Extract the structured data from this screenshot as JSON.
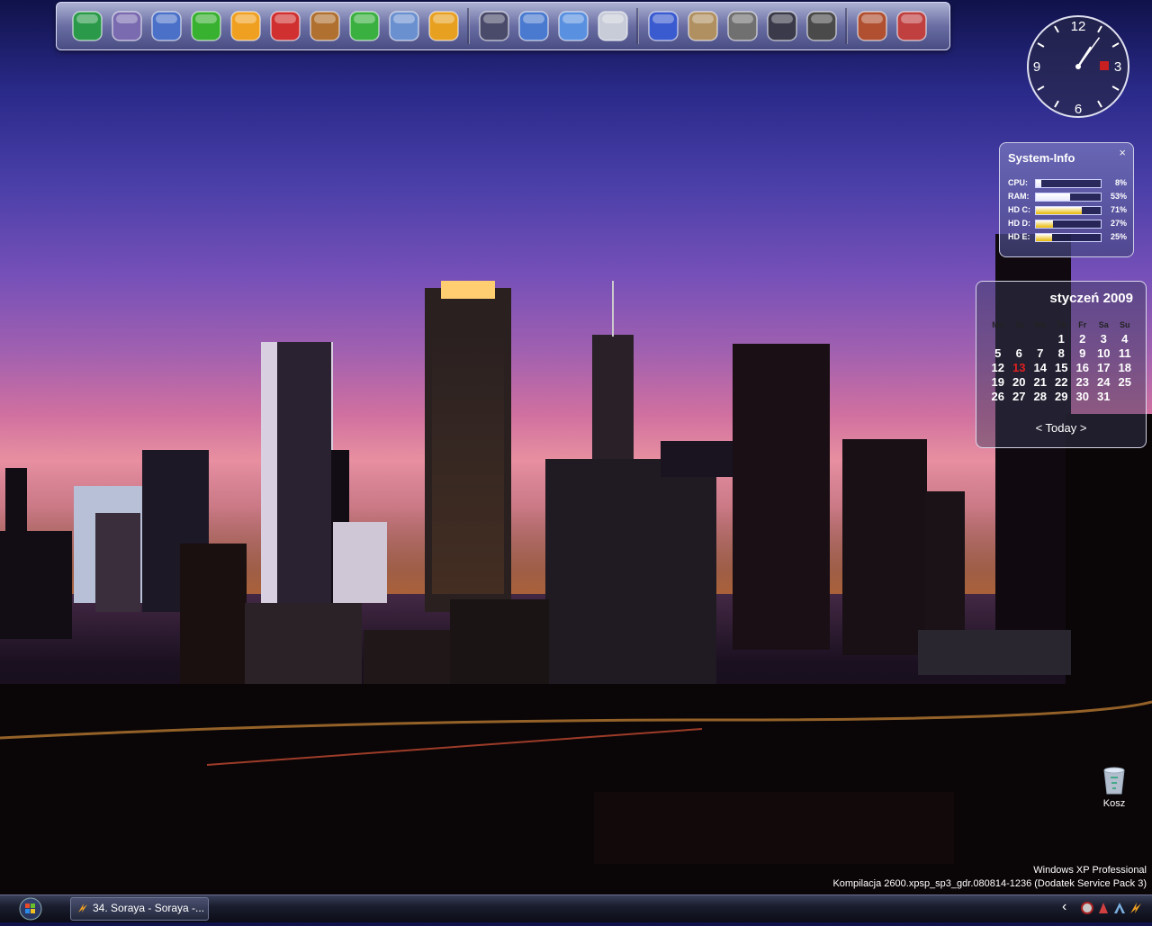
{
  "dock": {
    "icons": [
      {
        "name": "excel-icon",
        "group": 1
      },
      {
        "name": "paint-brushes-icon",
        "group": 1
      },
      {
        "name": "notes-pen-icon",
        "group": 1
      },
      {
        "name": "utorrent-icon",
        "group": 1
      },
      {
        "name": "info-icon",
        "group": 1
      },
      {
        "name": "acrobat-icon",
        "group": 1
      },
      {
        "name": "gopher-icon",
        "group": 1
      },
      {
        "name": "play-icon",
        "group": 1
      },
      {
        "name": "arch-icon",
        "group": 1
      },
      {
        "name": "winamp-icon",
        "group": 1
      },
      {
        "name": "media-tool-icon",
        "group": 2
      },
      {
        "name": "registry-cubes-icon",
        "group": 2
      },
      {
        "name": "cleanup-brush-icon",
        "group": 2
      },
      {
        "name": "disk-icon",
        "group": 2
      },
      {
        "name": "butterfly-network-icon",
        "group": 3
      },
      {
        "name": "archive-stack-icon",
        "group": 3
      },
      {
        "name": "film-reel-icon",
        "group": 3
      },
      {
        "name": "laptop-scan-icon",
        "group": 3
      },
      {
        "name": "camera-icon",
        "group": 3
      },
      {
        "name": "burner-icon",
        "group": 4
      },
      {
        "name": "tools-icon",
        "group": 4
      }
    ]
  },
  "clock": {
    "numerals": [
      "12",
      "3",
      "6",
      "9"
    ],
    "hour": 1,
    "minute": 6
  },
  "sysinfo": {
    "title": "System-Info",
    "close": "×",
    "rows": [
      {
        "label": "CPU:",
        "pct": "8%",
        "value": 0.08,
        "color": "#e8e8ff"
      },
      {
        "label": "RAM:",
        "pct": "53%",
        "value": 0.53,
        "color": "#e8e8ff"
      },
      {
        "label": "HD C:",
        "pct": "71%",
        "value": 0.71,
        "color": "#e8b800"
      },
      {
        "label": "HD D:",
        "pct": "27%",
        "value": 0.27,
        "color": "#e8b800"
      },
      {
        "label": "HD E:",
        "pct": "25%",
        "value": 0.25,
        "color": "#e8b800"
      }
    ]
  },
  "calendar": {
    "month": "styczeń  2009",
    "days": [
      "Mo",
      "Tu",
      "We",
      "Th",
      "Fr",
      "Sa",
      "Su"
    ],
    "weeks": [
      [
        "",
        "",
        "",
        "1",
        "2",
        "3",
        "4"
      ],
      [
        "5",
        "6",
        "7",
        "8",
        "9",
        "10",
        "11"
      ],
      [
        "12",
        "13",
        "14",
        "15",
        "16",
        "17",
        "18"
      ],
      [
        "19",
        "20",
        "21",
        "22",
        "23",
        "24",
        "25"
      ],
      [
        "26",
        "27",
        "28",
        "29",
        "30",
        "31",
        ""
      ]
    ],
    "today": "13",
    "nav": "<  Today  >"
  },
  "desktop": {
    "bin_label": "Kosz"
  },
  "watermark": {
    "line1": "Windows XP Professional",
    "line2": "Kompilacja 2600.xpsp_sp3_gdr.080814-1236 (Dodatek Service Pack 3)"
  },
  "taskbar": {
    "task_label": "34. Soraya - Soraya -...",
    "tray_chevron": "‹"
  },
  "colors": {
    "accent": "#e8b800",
    "today": "#e02020"
  }
}
